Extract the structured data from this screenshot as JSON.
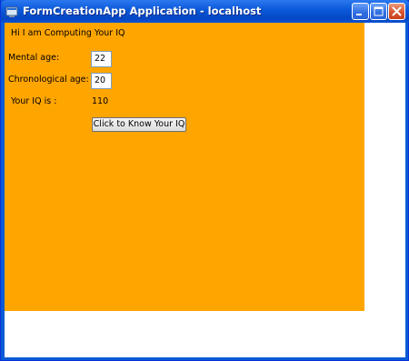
{
  "window": {
    "title": "FormCreationApp Application - localhost"
  },
  "form": {
    "greeting": "Hi I am Computing Your IQ",
    "mental_age_label": "Mental age:",
    "mental_age_value": "22",
    "chronological_age_label": "Chronological age:",
    "chronological_age_value": "20",
    "iq_label": "Your IQ is :",
    "iq_value": "110",
    "submit_label": "Click to Know Your IQ"
  },
  "colors": {
    "panel": "#ffa500",
    "titlebar": "#0a58d8"
  },
  "icons": [
    "app-icon",
    "minimize-icon",
    "maximize-icon",
    "close-icon"
  ]
}
